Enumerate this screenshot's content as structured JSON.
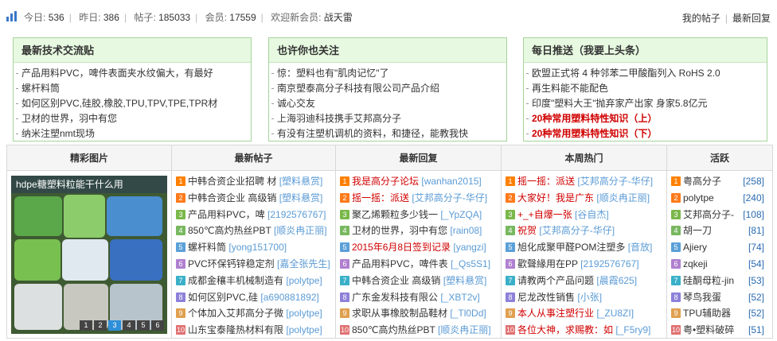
{
  "stats": {
    "today_label": "今日:",
    "today": "536",
    "yesterday_label": "昨日:",
    "yesterday": "386",
    "posts_label": "帖子:",
    "posts": "185033",
    "members_label": "会员:",
    "members": "17559",
    "welcome": "欢迎新会员:",
    "new_member": "战天雷"
  },
  "toplinks": {
    "my_posts": "我的帖子",
    "latest": "最新回复"
  },
  "boxes": [
    {
      "title": "最新技术交流贴",
      "items": [
        "产品用料PVC，啤件表面夹水纹偏大，有最好",
        "螺杆料筒",
        "如何区别PVC,硅胶,橡胶,TPU,TPV,TPE,TPR材",
        "卫材的世界，羽中有您",
        "纳米注塑nmt现场"
      ]
    },
    {
      "title": "也许你也关注",
      "items": [
        "惊：塑料也有\"肌肉记忆\"了",
        "南京塑泰高分子科技有限公司产品介绍",
        "诚心交友",
        "上海羽迪科技携手艾邦高分子",
        "有没有注塑机调机的资料，和捷径，能教我快"
      ]
    },
    {
      "title": "每日推送（我要上头条）",
      "items": [
        "欧盟正式将 4 种邻苯二甲酸酯列入 RoHS 2.0",
        "再生料能不能配色",
        "印度\"塑料大王\"抛弃家产出家 身家5.8亿元",
        "20种常用塑料特性知识（上）",
        "20种常用塑料特性知识（下）"
      ]
    }
  ],
  "columns": {
    "pics": "精彩图片",
    "latest_posts": "最新帖子",
    "latest_replies": "最新回复",
    "weekly_hot": "本周热门",
    "active": "活跃"
  },
  "slider": {
    "caption": "hdpe糖塑料粒能干什么用",
    "pages": [
      "1",
      "2",
      "3",
      "4",
      "5",
      "6"
    ],
    "active_page": "3"
  },
  "latest_posts": [
    {
      "n": "1",
      "t": "中韩合资企业招聘 材",
      "a": "[塑料悬赏]"
    },
    {
      "n": "2",
      "t": "中韩合资企业 高级销",
      "a": "[塑料悬赏]"
    },
    {
      "n": "3",
      "t": "产品用料PVC，啤",
      "a": "[2192576767]"
    },
    {
      "n": "4",
      "t": "850℃高灼热丝PBT",
      "a": "[顺炎冉正丽]"
    },
    {
      "n": "5",
      "t": "螺杆料筒",
      "a": "[yong151700]"
    },
    {
      "n": "6",
      "t": "PVC环保钙锌稳定剂",
      "a": "[嘉全张先生]"
    },
    {
      "n": "7",
      "t": "成都金穰丰机械制造有",
      "a": "[polytpe]"
    },
    {
      "n": "8",
      "t": "如何区别PVC,硅",
      "a": "[a690881892]"
    },
    {
      "n": "9",
      "t": "个体加入艾邦高分子微",
      "a": "[polytpe]"
    },
    {
      "n": "10",
      "t": "山东宝泰隆热材料有限",
      "a": "[polytpe]"
    }
  ],
  "latest_replies": [
    {
      "n": "1",
      "t": "我是高分子论坛",
      "a": "[wanhan2015]",
      "red": true
    },
    {
      "n": "2",
      "t": "摇一摇：派送",
      "a": "[艾邦高分子-华仔]",
      "red": true
    },
    {
      "n": "3",
      "t": "聚乙烯颗粒多少钱一",
      "a": "[_YpZQA]"
    },
    {
      "n": "4",
      "t": "卫材的世界，羽中有您",
      "a": "[rain08]"
    },
    {
      "n": "5",
      "t": "2015年6月8日签到记录",
      "a": "[yangzi]",
      "red": true
    },
    {
      "n": "6",
      "t": "产品用料PVC，啤件表",
      "a": "[_Qs5S1]"
    },
    {
      "n": "7",
      "t": "中韩合资企业 高级销",
      "a": "[塑料悬赏]"
    },
    {
      "n": "8",
      "t": "广东金发科技有限公",
      "a": "[_XBT2v]"
    },
    {
      "n": "9",
      "t": "求职从事橡胶制品鞋材",
      "a": "[_Tl0Dd]"
    },
    {
      "n": "10",
      "t": "850℃高灼热丝PBT",
      "a": "[顺炎冉正丽]"
    }
  ],
  "weekly_hot": [
    {
      "n": "1",
      "t": "摇一摇：派送",
      "a": "[艾邦高分子-华仔]",
      "red": true
    },
    {
      "n": "2",
      "t": "大家好！我是广东",
      "a": "[顺炎冉正丽]",
      "red": true
    },
    {
      "n": "3",
      "t": "+_+自爆一张",
      "a": "[谷自杰]",
      "red": true
    },
    {
      "n": "4",
      "t": "祝贺",
      "a": "[艾邦高分子-华仔]",
      "red": true
    },
    {
      "n": "5",
      "t": "旭化成聚甲醛POM注塑多",
      "a": "[音放]"
    },
    {
      "n": "6",
      "t": "歡聲緣用在PP",
      "a": "[2192576767]"
    },
    {
      "n": "7",
      "t": "请教两个产品问题",
      "a": "[晨霞625]"
    },
    {
      "n": "8",
      "t": "尼龙改性销售",
      "a": "[小张]"
    },
    {
      "n": "9",
      "t": "本人从事注塑行业",
      "a": "[_ZU8ZI]",
      "red": true
    },
    {
      "n": "10",
      "t": "各位大神，求赐教：如",
      "a": "[_F5ry9]",
      "red": true
    }
  ],
  "active": [
    {
      "n": "1",
      "t": "粤高分子",
      "c": "[258]"
    },
    {
      "n": "2",
      "t": "polytpe",
      "c": "[240]"
    },
    {
      "n": "3",
      "t": "艾邦高分子-",
      "c": "[108]"
    },
    {
      "n": "4",
      "t": "胡一刀",
      "c": "[81]"
    },
    {
      "n": "5",
      "t": "Ajiery",
      "c": "[74]"
    },
    {
      "n": "6",
      "t": "zqkeji",
      "c": "[54]"
    },
    {
      "n": "7",
      "t": "硅酮母粒-jin",
      "c": "[53]"
    },
    {
      "n": "8",
      "t": "琴鸟我蛋",
      "c": "[52]"
    },
    {
      "n": "9",
      "t": "TPU辅助器",
      "c": "[52]"
    },
    {
      "n": "10",
      "t": "粤•塑料破碎",
      "c": "[51]"
    }
  ]
}
